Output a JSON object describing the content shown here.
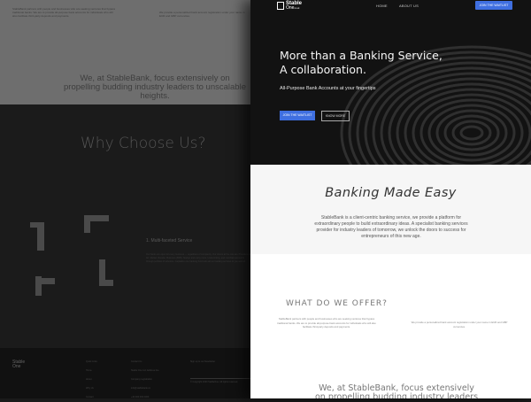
{
  "background_page": {
    "top_text_left": "StableBank partners with people and businesses who are seeking ventures that bypass traditional banks. We are to provide all-purpose bank accounts for individuals who will also facilitate third-party deposits and payments.",
    "top_text_right": "We provide a personalized bank account registration under your name in EUR and GBP currencies.",
    "quote": "We, at StableBank, focus extensively on propelling budding industry leaders to unscalable heights.",
    "why_title": "Why Choose Us?",
    "feature_title": "1.   Multi-faceted Service",
    "feature_text": "Our banks are open for every business — regardless of complexity. Our clients at the core are Providers of Ad, Market, Retailer, Business (B2B), Startup and many more. Underwriting, and merchant accounts through portfolio of solutions. Capitalize one banking fund suits all our banking services to you and all.",
    "footer_logo_line1": "Stable",
    "footer_logo_line2": "One",
    "footer_col1": [
      "Quick Links",
      "Home",
      "About",
      "Why Us",
      "Contact"
    ],
    "footer_col2": [
      "Contact Us",
      "Stable One Ltd, Address line",
      "Company registration",
      "info@stablebank.co",
      "+44 000 000 0000"
    ],
    "footer_newsletter": "Sign up to our Newsletter",
    "footer_copyright": "© Copyright 2020 StableOne. All rights reserved."
  },
  "nav": {
    "logo_line1": "Stable",
    "logo_line2": "One",
    "logo_suffix": "co.uk",
    "links": [
      "HOME",
      "ABOUT US"
    ],
    "cta": "JOIN THE WAITLIST"
  },
  "hero": {
    "title_line1": "More than a Banking Service,",
    "title_line2": "A collaboration.",
    "subtitle": "All-Purpose Bank Accounts at your fingertips",
    "primary_button": "JOIN THE WAITLIST",
    "secondary_button": "KNOW MORE"
  },
  "easy": {
    "title": "Banking Made Easy",
    "body": "StableBank is a client-centric banking service, we provide a platform for extraordinary people to build extraordinary ideas. A specialist banking services provider for industry leaders of tomorrow, we unlock the doors to success for entrepreneurs of this new age."
  },
  "offer": {
    "title": "WHAT DO WE OFFER?",
    "left_text": "StableBank partners with people and businesses who are seeking ventures that bypass traditional banks. We are to provide all-purpose bank accounts for individuals who will also facilitate third-party deposits and payments.",
    "right_text": "We provide a personalized bank account registration under your name in EUR and GBP currencies."
  },
  "quote": "We, at StableBank, focus extensively on propelling budding industry leaders to unscalable heights.",
  "colors": {
    "accent": "#3f6fe0",
    "hero_bg": "#121212",
    "dark_bg": "#1b1b1b"
  }
}
